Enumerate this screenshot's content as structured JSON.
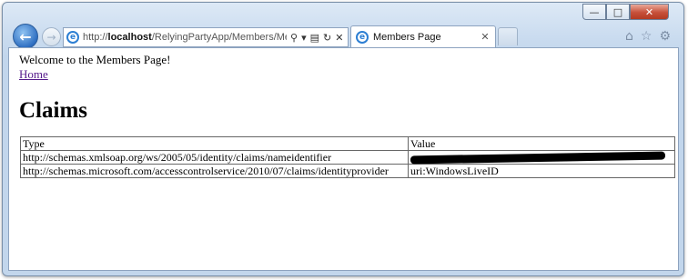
{
  "browser": {
    "url_prefix": "http://",
    "url_host": "localhost",
    "url_path": "/RelyingPartyApp/Members/Member",
    "tab_title": "Members Page",
    "icons": [
      "back-arrow-icon",
      "forward-arrow-icon",
      "ie-logo-icon",
      "search-icon",
      "refresh-icon",
      "stop-icon",
      "home-icon",
      "favorites-star-icon",
      "tools-gear-icon"
    ]
  },
  "page": {
    "welcome": "Welcome to the Members Page!",
    "home_link": "Home",
    "heading": "Claims",
    "table": {
      "headers": [
        "Type",
        "Value"
      ],
      "rows": [
        {
          "type": "http://schemas.xmlsoap.org/ws/2005/05/identity/claims/nameidentifier",
          "value": "",
          "redacted": true
        },
        {
          "type": "http://schemas.microsoft.com/accesscontrolservice/2010/07/claims/identityprovider",
          "value": "uri:WindowsLiveID",
          "redacted": false
        }
      ]
    }
  }
}
